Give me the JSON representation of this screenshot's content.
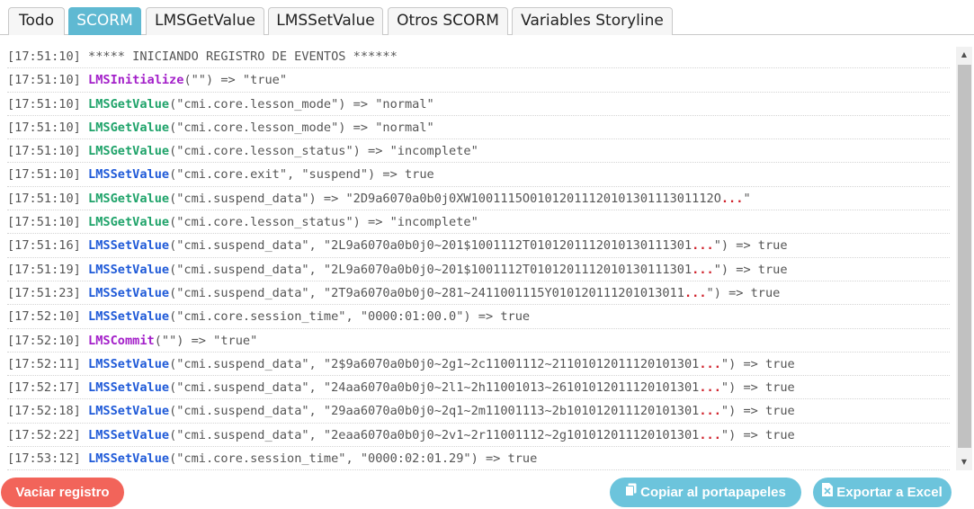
{
  "tabs": [
    {
      "label": "Todo",
      "active": false
    },
    {
      "label": "SCORM",
      "active": true
    },
    {
      "label": "LMSGetValue",
      "active": false
    },
    {
      "label": "LMSSetValue",
      "active": false
    },
    {
      "label": "Otros SCORM",
      "active": false
    },
    {
      "label": "Variables Storyline",
      "active": false
    }
  ],
  "colors": {
    "active_tab": "#5fb9d2",
    "get_fn": "#1fa36a",
    "set_fn": "#1f5ad8",
    "sys_fn": "#a31fc9",
    "ellipsis": "#d0202a",
    "clear_button": "#f2645a",
    "action_button": "#6cc4dc"
  },
  "log": [
    {
      "ts": "[17:51:10]",
      "fn": "",
      "kind": "",
      "text": " ***** INICIANDO REGISTRO DE EVENTOS ******",
      "ellipsis": "",
      "tail": ""
    },
    {
      "ts": "[17:51:10]",
      "fn": "LMSInitialize",
      "kind": "sys",
      "text": "(\"\") => \"true\"",
      "ellipsis": "",
      "tail": ""
    },
    {
      "ts": "[17:51:10]",
      "fn": "LMSGetValue",
      "kind": "get",
      "text": "(\"cmi.core.lesson_mode\") => \"normal\"",
      "ellipsis": "",
      "tail": ""
    },
    {
      "ts": "[17:51:10]",
      "fn": "LMSGetValue",
      "kind": "get",
      "text": "(\"cmi.core.lesson_mode\") => \"normal\"",
      "ellipsis": "",
      "tail": ""
    },
    {
      "ts": "[17:51:10]",
      "fn": "LMSGetValue",
      "kind": "get",
      "text": "(\"cmi.core.lesson_status\") => \"incomplete\"",
      "ellipsis": "",
      "tail": ""
    },
    {
      "ts": "[17:51:10]",
      "fn": "LMSSetValue",
      "kind": "set",
      "text": "(\"cmi.core.exit\", \"suspend\") => true",
      "ellipsis": "",
      "tail": ""
    },
    {
      "ts": "[17:51:10]",
      "fn": "LMSGetValue",
      "kind": "get",
      "text": "(\"cmi.suspend_data\") => \"2D9a6070a0b0j0XW1001115O0101201112010130111301112O",
      "ellipsis": "...",
      "tail": "\""
    },
    {
      "ts": "[17:51:10]",
      "fn": "LMSGetValue",
      "kind": "get",
      "text": "(\"cmi.core.lesson_status\") => \"incomplete\"",
      "ellipsis": "",
      "tail": ""
    },
    {
      "ts": "[17:51:16]",
      "fn": "LMSSetValue",
      "kind": "set",
      "text": "(\"cmi.suspend_data\", \"2L9a6070a0b0j0~201$1001112T0101201112010130111301",
      "ellipsis": "...",
      "tail": "\") => true"
    },
    {
      "ts": "[17:51:19]",
      "fn": "LMSSetValue",
      "kind": "set",
      "text": "(\"cmi.suspend_data\", \"2L9a6070a0b0j0~201$1001112T0101201112010130111301",
      "ellipsis": "...",
      "tail": "\") => true"
    },
    {
      "ts": "[17:51:23]",
      "fn": "LMSSetValue",
      "kind": "set",
      "text": "(\"cmi.suspend_data\", \"2T9a6070a0b0j0~281~2411001115Y010120111201013011",
      "ellipsis": "...",
      "tail": "\") => true"
    },
    {
      "ts": "[17:52:10]",
      "fn": "LMSSetValue",
      "kind": "set",
      "text": "(\"cmi.core.session_time\", \"0000:01:00.0\") => true",
      "ellipsis": "",
      "tail": ""
    },
    {
      "ts": "[17:52:10]",
      "fn": "LMSCommit",
      "kind": "sys",
      "text": "(\"\") => \"true\"",
      "ellipsis": "",
      "tail": ""
    },
    {
      "ts": "[17:52:11]",
      "fn": "LMSSetValue",
      "kind": "set",
      "text": "(\"cmi.suspend_data\", \"2$9a6070a0b0j0~2g1~2c11001112~21101012011120101301",
      "ellipsis": "...",
      "tail": "\") => true"
    },
    {
      "ts": "[17:52:17]",
      "fn": "LMSSetValue",
      "kind": "set",
      "text": "(\"cmi.suspend_data\", \"24aa6070a0b0j0~2l1~2h11001013~26101012011120101301",
      "ellipsis": "...",
      "tail": "\") => true"
    },
    {
      "ts": "[17:52:18]",
      "fn": "LMSSetValue",
      "kind": "set",
      "text": "(\"cmi.suspend_data\", \"29aa6070a0b0j0~2q1~2m11001113~2b101012011120101301",
      "ellipsis": "...",
      "tail": "\") => true"
    },
    {
      "ts": "[17:52:22]",
      "fn": "LMSSetValue",
      "kind": "set",
      "text": "(\"cmi.suspend_data\", \"2eaa6070a0b0j0~2v1~2r11001112~2g101012011120101301",
      "ellipsis": "...",
      "tail": "\") => true"
    },
    {
      "ts": "[17:53:12]",
      "fn": "LMSSetValue",
      "kind": "set",
      "text": "(\"cmi.core.session_time\", \"0000:02:01.29\") => true",
      "ellipsis": "",
      "tail": ""
    }
  ],
  "buttons": {
    "clear": "Vaciar registro",
    "copy": "Copiar al portapapeles",
    "export": "Exportar a Excel"
  },
  "icons": {
    "copy": "clipboard-icon",
    "export": "excel-file-icon"
  }
}
